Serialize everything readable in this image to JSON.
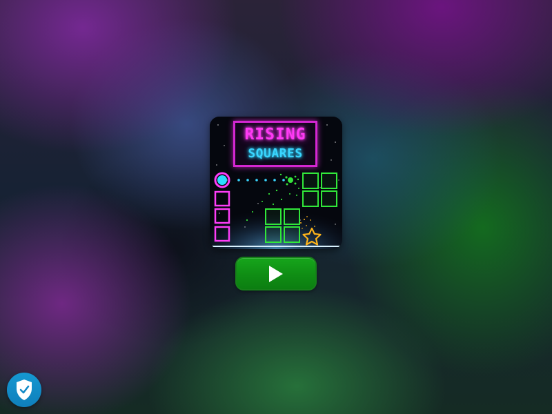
{
  "game": {
    "title_line_1": "RISING",
    "title_line_2": "SQUARES"
  },
  "controls": {
    "play_icon": "play-icon"
  },
  "security_badge": {
    "icon": "shield-check-icon"
  },
  "colors": {
    "title_pink": "#ff39f5",
    "title_blue": "#39d6ff",
    "neon_green": "#32e83a",
    "play_green": "#12991a",
    "badge_blue": "#118ac7"
  }
}
